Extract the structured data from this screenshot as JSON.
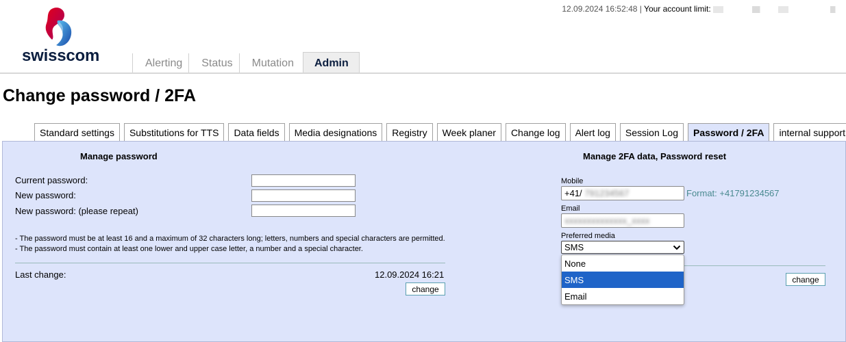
{
  "header": {
    "brand": "swisscom",
    "datetime": "12.09.2024 16:52:48",
    "separator": "|",
    "account_limit_label": "Your account limit:"
  },
  "main_tabs": [
    {
      "label": "Alerting",
      "active": false
    },
    {
      "label": "Status",
      "active": false
    },
    {
      "label": "Mutation",
      "active": false
    },
    {
      "label": "Admin",
      "active": true
    }
  ],
  "page_title": "Change password / 2FA",
  "sub_tabs": [
    {
      "label": "Standard settings"
    },
    {
      "label": "Substitutions for TTS"
    },
    {
      "label": "Data fields"
    },
    {
      "label": "Media designations"
    },
    {
      "label": "Registry"
    },
    {
      "label": "Week planer"
    },
    {
      "label": "Change log"
    },
    {
      "label": "Alert log"
    },
    {
      "label": "Session Log"
    },
    {
      "label": "Password / 2FA"
    },
    {
      "label": "internal support center"
    }
  ],
  "password": {
    "title": "Manage password",
    "current_label": "Current password:",
    "new_label": "New password:",
    "repeat_label": "New password: (please repeat)",
    "note1": "- The password must be at least 16 and a maximum of 32 characters long; letters, numbers and special characters are permitted.",
    "note2": "- The password must contain at least one lower and upper case letter, a number and a special character.",
    "last_change_label": "Last change:",
    "last_change_value": "12.09.2024 16:21",
    "change_button": "change"
  },
  "twofa": {
    "title": "Manage 2FA data, Password reset",
    "mobile_label": "Mobile",
    "mobile_value": "+41/",
    "mobile_hidden": "791234567",
    "format_hint": "Format: +41791234567",
    "email_label": "Email",
    "email_hidden": "xxxxxxxxxxxxxx_xxxx",
    "media_label": "Preferred media",
    "media_selected": "SMS",
    "media_options": [
      "None",
      "SMS",
      "Email"
    ],
    "change_button": "change"
  },
  "colors": {
    "panel_bg": "#dde4fb",
    "selected_option": "#1f64c8",
    "hint": "#4a8a90",
    "brand_dark": "#0b1e3f"
  }
}
